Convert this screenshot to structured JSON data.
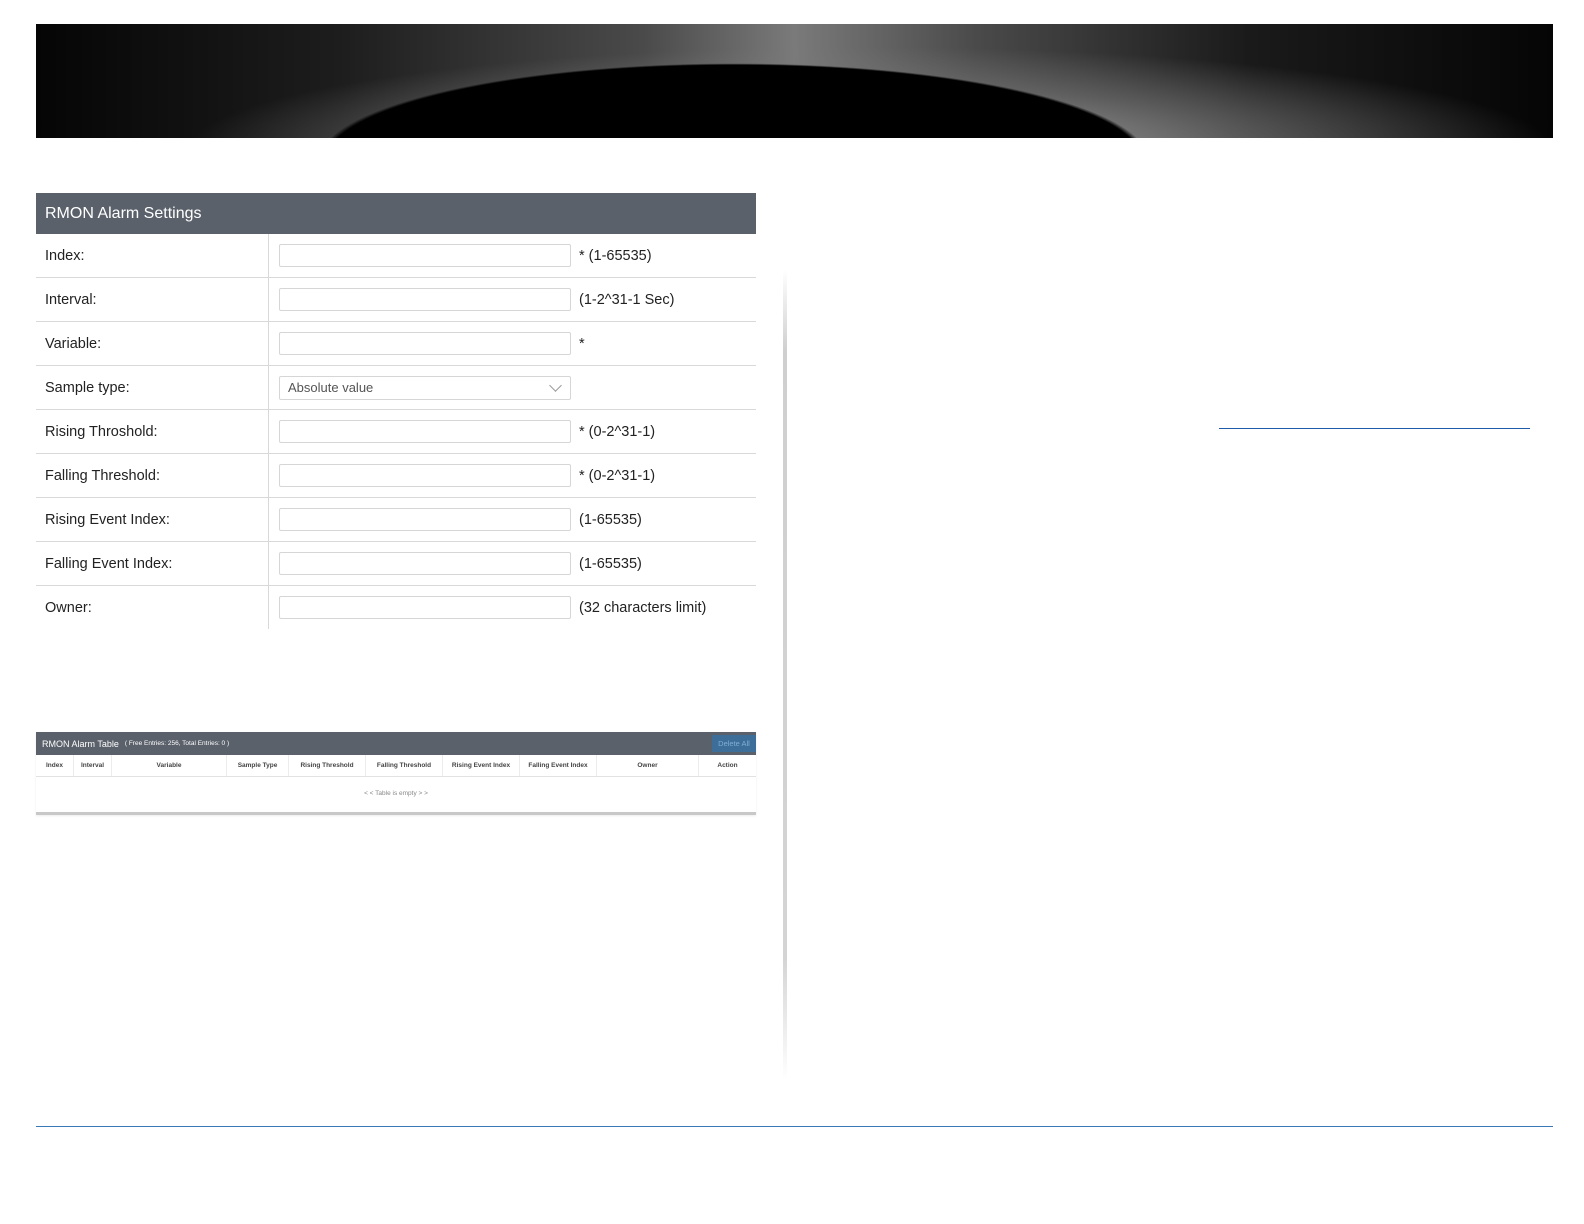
{
  "settings": {
    "title": "RMON Alarm Settings",
    "fields": [
      {
        "label": "Index:",
        "hint": "* (1-65535)",
        "value": ""
      },
      {
        "label": "Interval:",
        "hint": "(1-2^31-1 Sec)",
        "value": ""
      },
      {
        "label": "Variable:",
        "hint": "*",
        "value": ""
      },
      {
        "label": "Sample type:",
        "hint": "",
        "value": "Absolute value"
      },
      {
        "label": "Rising Throshold:",
        "hint": "* (0-2^31-1)",
        "value": ""
      },
      {
        "label": "Falling Threshold:",
        "hint": "* (0-2^31-1)",
        "value": ""
      },
      {
        "label": "Rising Event Index:",
        "hint": "(1-65535)",
        "value": ""
      },
      {
        "label": "Falling Event Index:",
        "hint": "(1-65535)",
        "value": ""
      },
      {
        "label": "Owner:",
        "hint": "(32 characters limit)",
        "value": ""
      }
    ]
  },
  "alarm_table": {
    "title": "RMON Alarm Table",
    "entries": "( Free Entries: 256, Total Entries: 0 )",
    "delete_all_label": "Delete All",
    "columns": [
      "Index",
      "Interval",
      "Variable",
      "Sample Type",
      "Rising Threshold",
      "Falling Threshold",
      "Rising Event Index",
      "Falling Event Index",
      "Owner",
      "Action"
    ],
    "empty_text": "< < Table is empty > >"
  },
  "colors": {
    "panel_header": "#5a616b",
    "delete_button": "#3d6e99",
    "footer_rule": "#3a78b8",
    "link": "#1f5aa8"
  }
}
